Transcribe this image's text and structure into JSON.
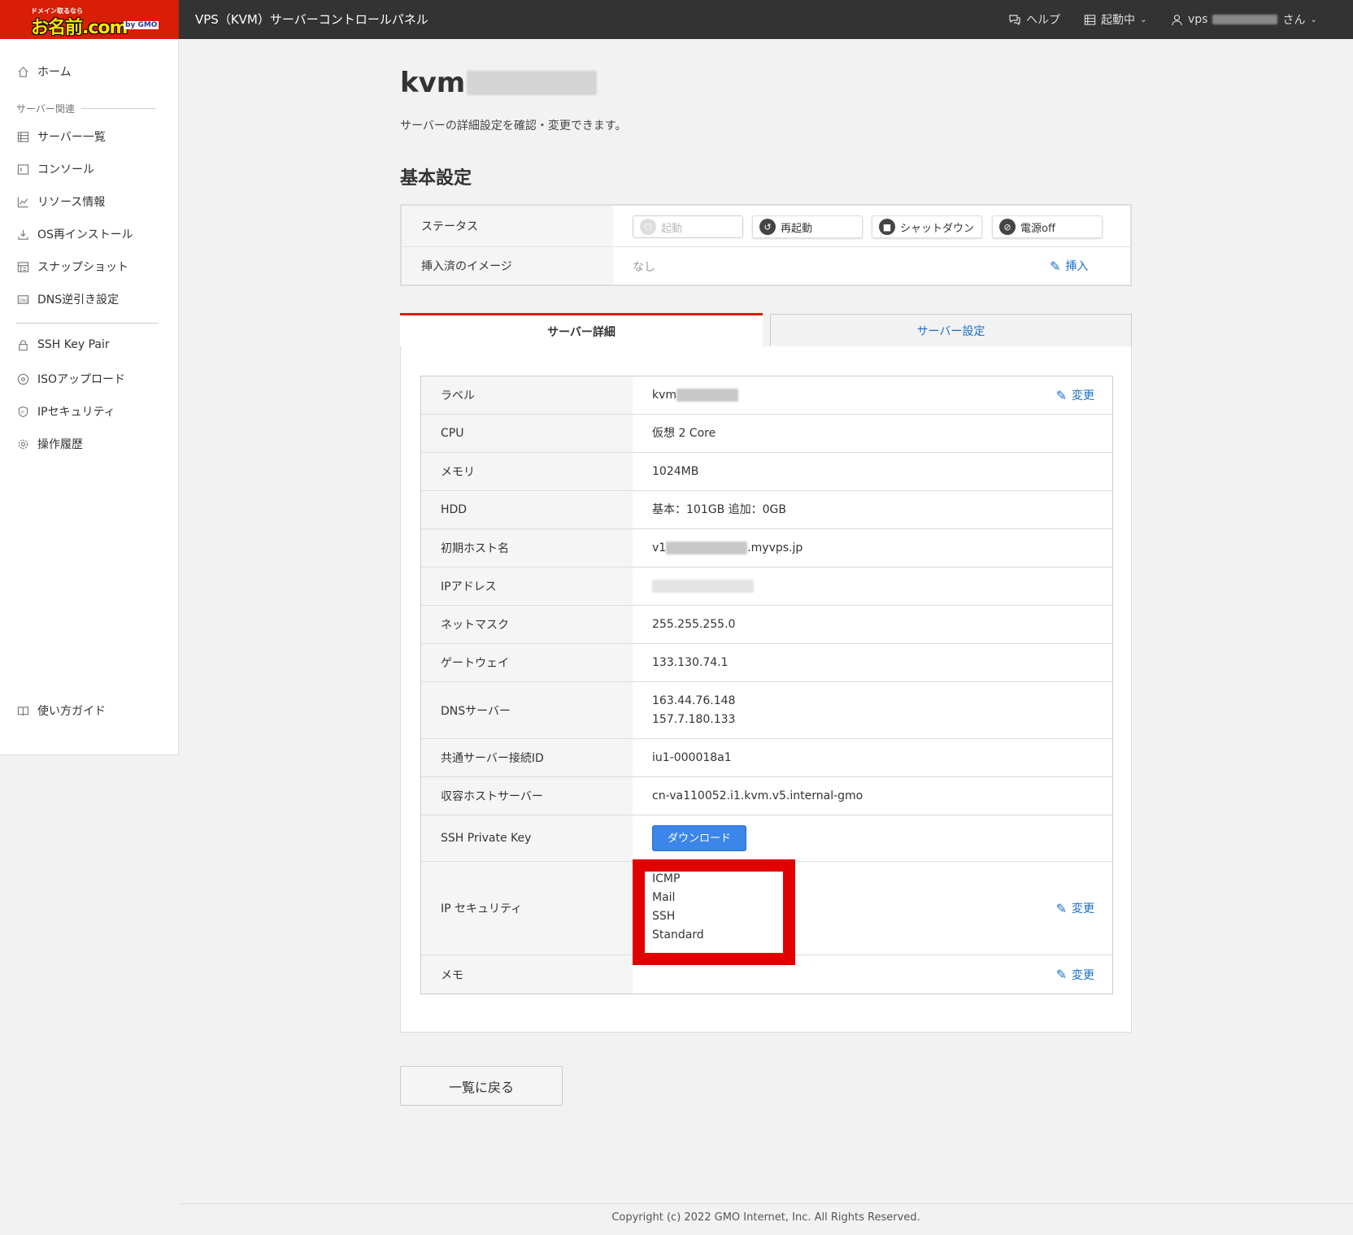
{
  "header": {
    "logo_tag": "ドメイン取るなら",
    "logo_brand": "お名前.com",
    "logo_gmo": "by GMO",
    "app_title": "VPS（KVM）サーバーコントロールパネル",
    "help": "ヘルプ",
    "status": "起動中",
    "user_prefix": "vps",
    "user_suffix": "さん"
  },
  "sidebar": {
    "home": "ホーム",
    "section_server": "サーバー関連",
    "items": [
      {
        "label": "サーバー一覧",
        "icon": "list-icon"
      },
      {
        "label": "コンソール",
        "icon": "terminal-icon"
      },
      {
        "label": "リソース情報",
        "icon": "chart-icon"
      },
      {
        "label": "OS再インストール",
        "icon": "download-icon"
      },
      {
        "label": "スナップショット",
        "icon": "snapshot-icon"
      },
      {
        "label": "DNS逆引き設定",
        "icon": "dns-icon"
      }
    ],
    "items2": [
      {
        "label": "SSH Key Pair",
        "icon": "lock-icon"
      },
      {
        "label": "ISOアップロード",
        "icon": "disc-icon"
      },
      {
        "label": "IPセキュリティ",
        "icon": "shield-icon"
      },
      {
        "label": "操作履歴",
        "icon": "gear-icon"
      }
    ],
    "guide": "使い方ガイド"
  },
  "main": {
    "title": "kvm",
    "description": "サーバーの詳細設定を確認・変更できます。",
    "basic_title": "基本設定",
    "status_label": "ステータス",
    "power_buttons": {
      "start": "起動",
      "restart": "再起動",
      "shutdown": "シャットダウン",
      "power_off": "電源off"
    },
    "image_label": "挿入済のイメージ",
    "image_value": "なし",
    "insert_link": "挿入",
    "tab_detail": "サーバー詳細",
    "tab_settings": "サーバー設定",
    "details": {
      "label_key": "ラベル",
      "label_value": "kvm",
      "cpu_key": "CPU",
      "cpu_value": "仮想 2 Core",
      "memory_key": "メモリ",
      "memory_value": "1024MB",
      "hdd_key": "HDD",
      "hdd_value": "基本：101GB 追加：0GB",
      "hostname_key": "初期ホスト名",
      "hostname_prefix": "v1",
      "hostname_suffix": ".myvps.jp",
      "ip_key": "IPアドレス",
      "netmask_key": "ネットマスク",
      "netmask_value": "255.255.255.0",
      "gateway_key": "ゲートウェイ",
      "gateway_value": "133.130.74.1",
      "dns_key": "DNSサーバー",
      "dns1": "163.44.76.148",
      "dns2": "157.7.180.133",
      "shared_id_key": "共通サーバー接続ID",
      "shared_id_value": "iu1-000018a1",
      "host_server_key": "収容ホストサーバー",
      "host_server_value": "cn-va110052.i1.kvm.v5.internal-gmo",
      "ssh_key": "SSH Private Key",
      "download": "ダウンロード",
      "ipsec_key": "IP セキュリティ",
      "ipsec_values": [
        "ICMP",
        "Mail",
        "SSH",
        "Standard"
      ],
      "memo_key": "メモ"
    },
    "edit_label": "変更",
    "back_button": "一覧に戻る"
  },
  "footer": "Copyright (c) 2022 GMO Internet, Inc. All Rights Reserved.",
  "colors": {
    "brand_red": "#d81e05",
    "header_bg": "#333333",
    "link_blue": "#1a6fc4",
    "button_blue": "#3b86e8",
    "highlight": "#e00000"
  }
}
